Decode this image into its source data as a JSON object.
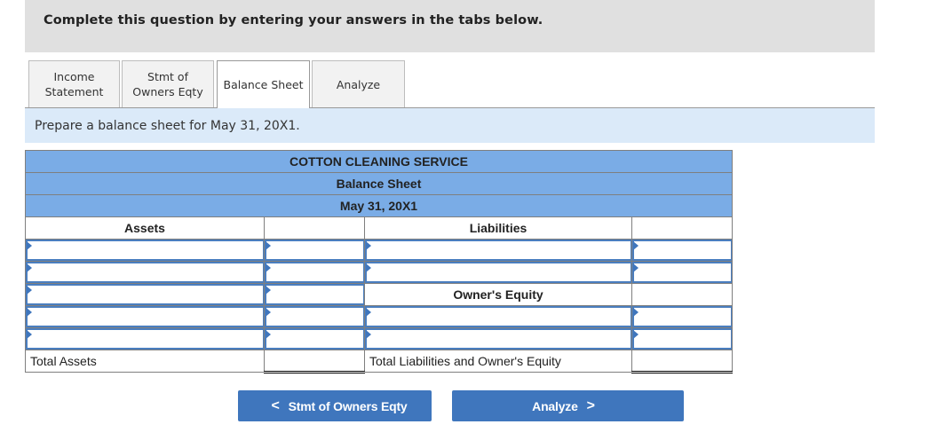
{
  "banner": {
    "text": "Complete this question by entering your answers in the tabs below."
  },
  "tabs": [
    {
      "line1": "Income",
      "line2": "Statement",
      "active": false
    },
    {
      "line1": "Stmt of",
      "line2": "Owners Eqty",
      "active": false
    },
    {
      "line1": "Balance Sheet",
      "line2": "",
      "active": true
    },
    {
      "line1": "Analyze",
      "line2": "",
      "active": false
    }
  ],
  "instruction": "Prepare a balance sheet for May 31, 20X1.",
  "balance_sheet": {
    "company": "COTTON CLEANING SERVICE",
    "title": "Balance Sheet",
    "date": "May 31, 20X1",
    "assets_header": "Assets",
    "liabilities_header": "Liabilities",
    "equity_header": "Owner's Equity",
    "total_assets_label": "Total Assets",
    "total_liab_equity_label": "Total Liabilities and Owner's Equity",
    "asset_rows": [
      {
        "name": "",
        "amount": ""
      },
      {
        "name": "",
        "amount": ""
      },
      {
        "name": "",
        "amount": ""
      },
      {
        "name": "",
        "amount": ""
      },
      {
        "name": "",
        "amount": ""
      }
    ],
    "liability_rows": [
      {
        "name": "",
        "amount": ""
      },
      {
        "name": "",
        "amount": ""
      }
    ],
    "equity_rows": [
      {
        "name": "",
        "amount": ""
      },
      {
        "name": "",
        "amount": ""
      }
    ],
    "total_assets": "",
    "total_liab_equity": ""
  },
  "nav": {
    "prev_label": "Stmt of Owners Eqty",
    "next_label": "Analyze",
    "prev_icon": "<",
    "next_icon": ">"
  },
  "colors": {
    "accent": "#3f76bd",
    "table_header": "#7aace6",
    "instruction_bg": "#dbeaf9",
    "banner_bg": "#e0e0e0"
  }
}
